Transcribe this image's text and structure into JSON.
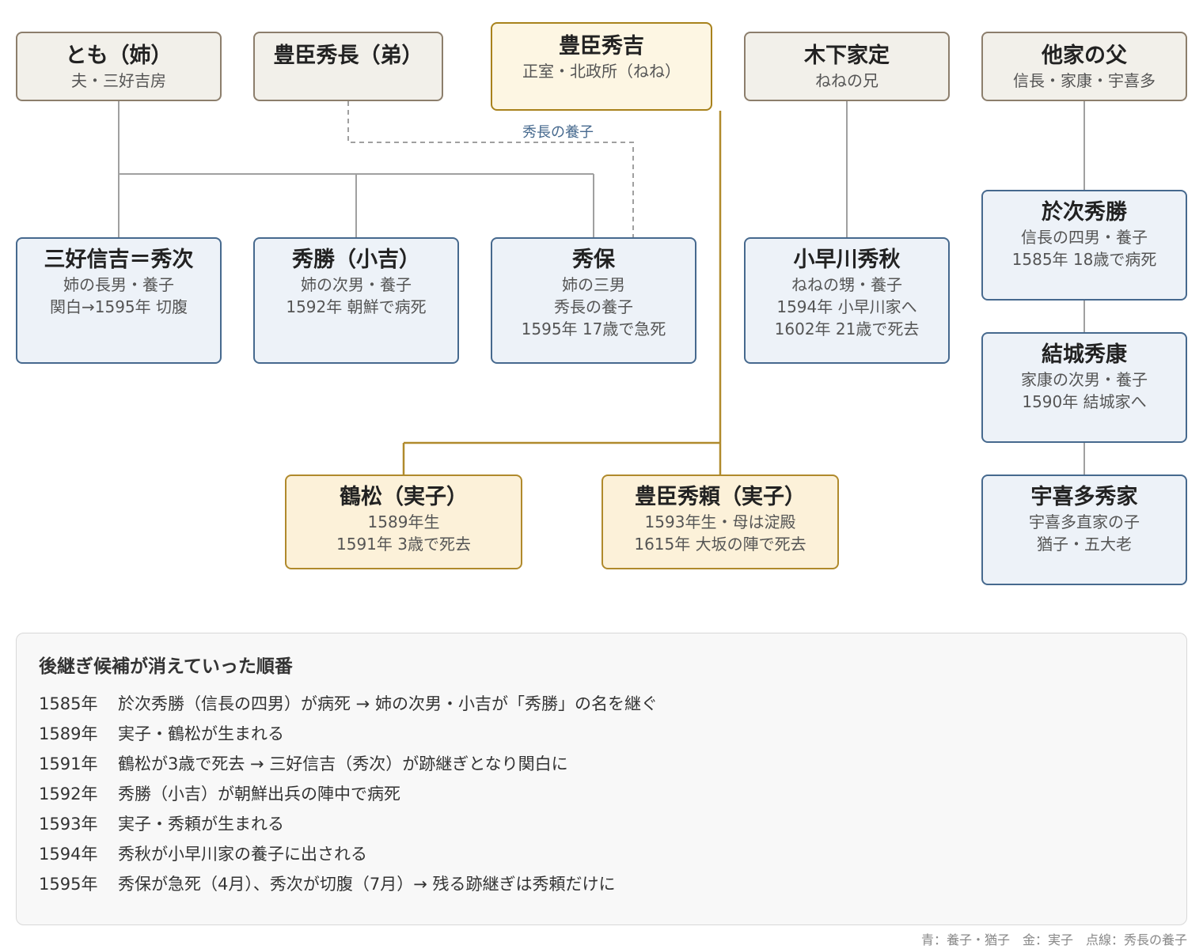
{
  "parents": [
    {
      "name": "とも（姉）",
      "sub": "夫・三好吉房"
    },
    {
      "name": "豊臣秀長（弟）",
      "sub": ""
    },
    {
      "name": "豊臣秀吉",
      "sub": "正室・北政所（ねね）"
    },
    {
      "name": "木下家定",
      "sub": "ねねの兄"
    },
    {
      "name": "他家の父",
      "sub": "信長・家康・宇喜多"
    }
  ],
  "children": [
    {
      "name": "三好信吉＝秀次",
      "sub": "姉の長男・養子\n関白→1595年 切腹"
    },
    {
      "name": "秀勝（小吉）",
      "sub": "姉の次男・養子\n1592年 朝鮮で病死"
    },
    {
      "name": "秀保",
      "sub": "姉の三男\n秀長の養子\n1595年 17歳で急死"
    },
    {
      "name": "小早川秀秋",
      "sub": "ねねの甥・養子\n1594年 小早川家へ\n1602年 21歳で死去"
    }
  ],
  "others": [
    {
      "name": "於次秀勝",
      "sub": "信長の四男・養子\n1585年 18歳で病死"
    },
    {
      "name": "結城秀康",
      "sub": "家康の次男・養子\n1590年 結城家へ"
    },
    {
      "name": "宇喜多秀家",
      "sub": "宇喜多直家の子\n猶子・五大老"
    }
  ],
  "biological": [
    {
      "name": "鶴松（実子）",
      "sub": "1589年生\n1591年 3歳で死去"
    },
    {
      "name": "豊臣秀頼（実子）",
      "sub": "1593年生・母は淀殿\n1615年 大坂の陣で死去"
    }
  ],
  "edge_label": "秀長の養子",
  "summary": {
    "title": "後継ぎ候補が消えていった順番",
    "events": [
      {
        "year": "1585年",
        "text": "於次秀勝（信長の四男）が病死 → 姉の次男・小吉が「秀勝」の名を継ぐ"
      },
      {
        "year": "1589年",
        "text": "実子・鶴松が生まれる"
      },
      {
        "year": "1591年",
        "text": "鶴松が3歳で死去 → 三好信吉（秀次）が跡継ぎとなり関白に"
      },
      {
        "year": "1592年",
        "text": "秀勝（小吉）が朝鮮出兵の陣中で病死"
      },
      {
        "year": "1593年",
        "text": "実子・秀頼が生まれる"
      },
      {
        "year": "1594年",
        "text": "秀秋が小早川家の養子に出される"
      },
      {
        "year": "1595年",
        "text": "秀保が急死（4月）、秀次が切腹（7月）→ 残る跡継ぎは秀頼だけに"
      }
    ]
  },
  "legend": "青：養子・猶子　金：実子　点線：秀長の養子",
  "colors": {
    "adopted": "#46698e",
    "biological": "#b08a2c",
    "line_gray": "#a0a0a0"
  }
}
